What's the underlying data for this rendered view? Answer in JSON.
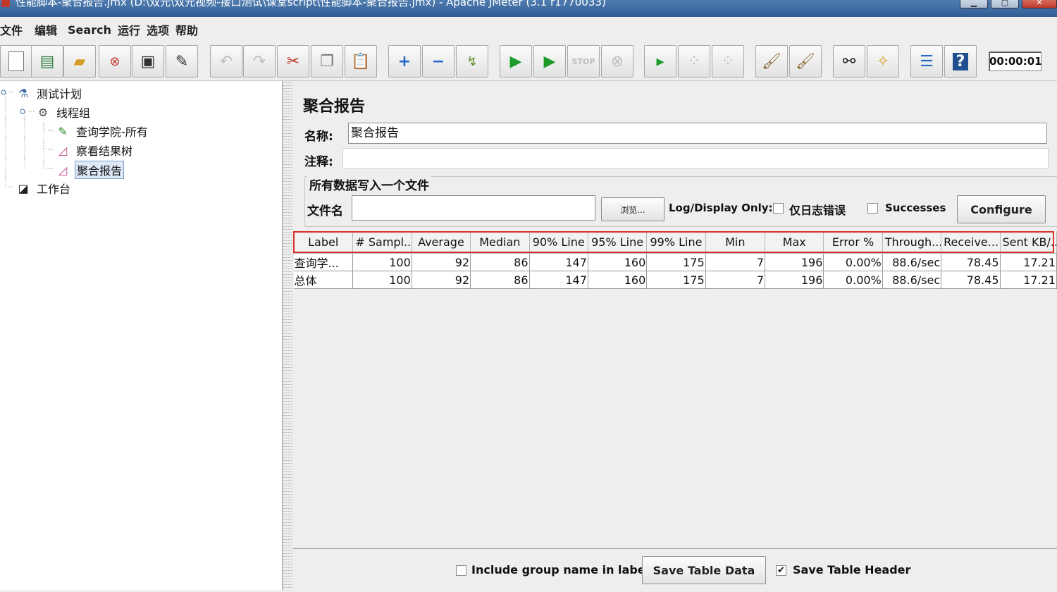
{
  "window": {
    "title": "性能脚本-聚合报告.jmx (D:\\双元\\双元视频-接口测试\\课堂script\\性能脚本-聚合报告.jmx) - Apache JMeter (3.1 r1770033)"
  },
  "menu": [
    "文件",
    "编辑",
    "Search",
    "运行",
    "选项",
    "帮助"
  ],
  "toolbar": {
    "icons": [
      "new-icon",
      "templates-icon",
      "open-icon",
      "close-icon",
      "save-icon",
      "save-as-icon",
      "undo-icon",
      "redo-icon",
      "cut-icon",
      "copy-icon",
      "paste-icon",
      "expand-icon",
      "collapse-icon",
      "toggle-icon",
      "start-icon",
      "start-no-pause-icon",
      "stop-icon",
      "shutdown-icon",
      "remote-start-icon",
      "remote-stop-icon",
      "remote-shutdown-icon",
      "clear-icon",
      "clear-all-icon",
      "search-icon",
      "reset-search-icon",
      "function-helper-icon",
      "help-icon"
    ],
    "timer": "00:00:01"
  },
  "tree": {
    "items": [
      {
        "label": "测试计划",
        "icon": "test-plan-icon"
      },
      {
        "label": "线程组",
        "icon": "thread-group-icon"
      },
      {
        "label": "查询学院-所有",
        "icon": "http-sampler-icon"
      },
      {
        "label": "察看结果树",
        "icon": "listener-icon"
      },
      {
        "label": "聚合报告",
        "icon": "listener-icon"
      },
      {
        "label": "工作台",
        "icon": "workbench-icon"
      }
    ]
  },
  "panel": {
    "title": "聚合报告",
    "name_label": "名称:",
    "name_value": "聚合报告",
    "comment_label": "注释:",
    "comment_value": "",
    "file_group_title": "所有数据写入一个文件",
    "filename_label": "文件名",
    "filename_value": "",
    "browse_label": "浏览...",
    "log_display_label": "Log/Display Only:",
    "errors_only_label": "仅日志错误",
    "errors_only_checked": false,
    "successes_label": "Successes",
    "successes_checked": false,
    "configure_label": "Configure"
  },
  "table": {
    "headers": [
      "Label",
      "# Sampl...",
      "Average",
      "Median",
      "90% Line",
      "95% Line",
      "99% Line",
      "Min",
      "Max",
      "Error %",
      "Through...",
      "Receive...",
      "Sent KB/..."
    ],
    "rows": [
      [
        "查询学...",
        "100",
        "92",
        "86",
        "147",
        "160",
        "175",
        "7",
        "196",
        "0.00%",
        "88.6/sec",
        "78.45",
        "17.21"
      ],
      [
        "总体",
        "100",
        "92",
        "86",
        "147",
        "160",
        "175",
        "7",
        "196",
        "0.00%",
        "88.6/sec",
        "78.45",
        "17.21"
      ]
    ]
  },
  "bottom": {
    "include_group_label": "Include group name in label?",
    "include_group_checked": false,
    "save_table_data_label": "Save Table Data",
    "save_header_label": "Save Table Header",
    "save_header_checked": true
  },
  "colors": {
    "highlight_border": "#d9302c",
    "selection_bg": "#dfe8f6",
    "title_bar": "#2f5c93"
  }
}
